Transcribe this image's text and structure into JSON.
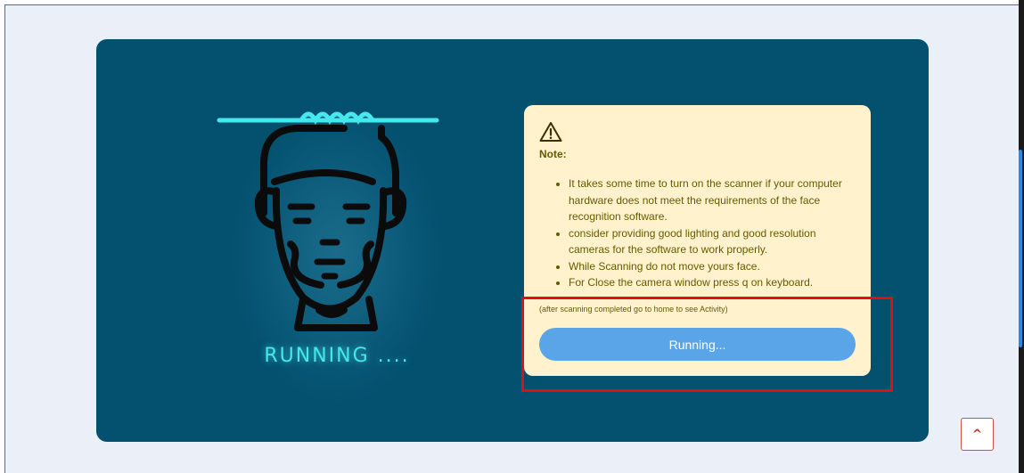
{
  "scanner": {
    "status_text": "RUNNING ...."
  },
  "note": {
    "icon": "warning-triangle-icon",
    "title": "Note:",
    "items": [
      "It takes some time to turn on the scanner if your computer hardware does not meet the requirements of the face recognition software.",
      "consider providing good lighting and good resolution cameras for the software to work properly.",
      "While Scanning do not move yours face.",
      "For Close the camera window press q on keyboard."
    ],
    "after_text": "(after scanning completed go to home to see Activity)",
    "button_label": "Running..."
  },
  "scroll_top": {
    "label": "^",
    "icon": "caret-up-icon"
  },
  "colors": {
    "panel": "#03506f",
    "accent_cyan": "#45e8ec",
    "note_bg": "#fff2cc",
    "note_text": "#665a00",
    "button": "#5aa5e8",
    "highlight": "#e01010"
  }
}
